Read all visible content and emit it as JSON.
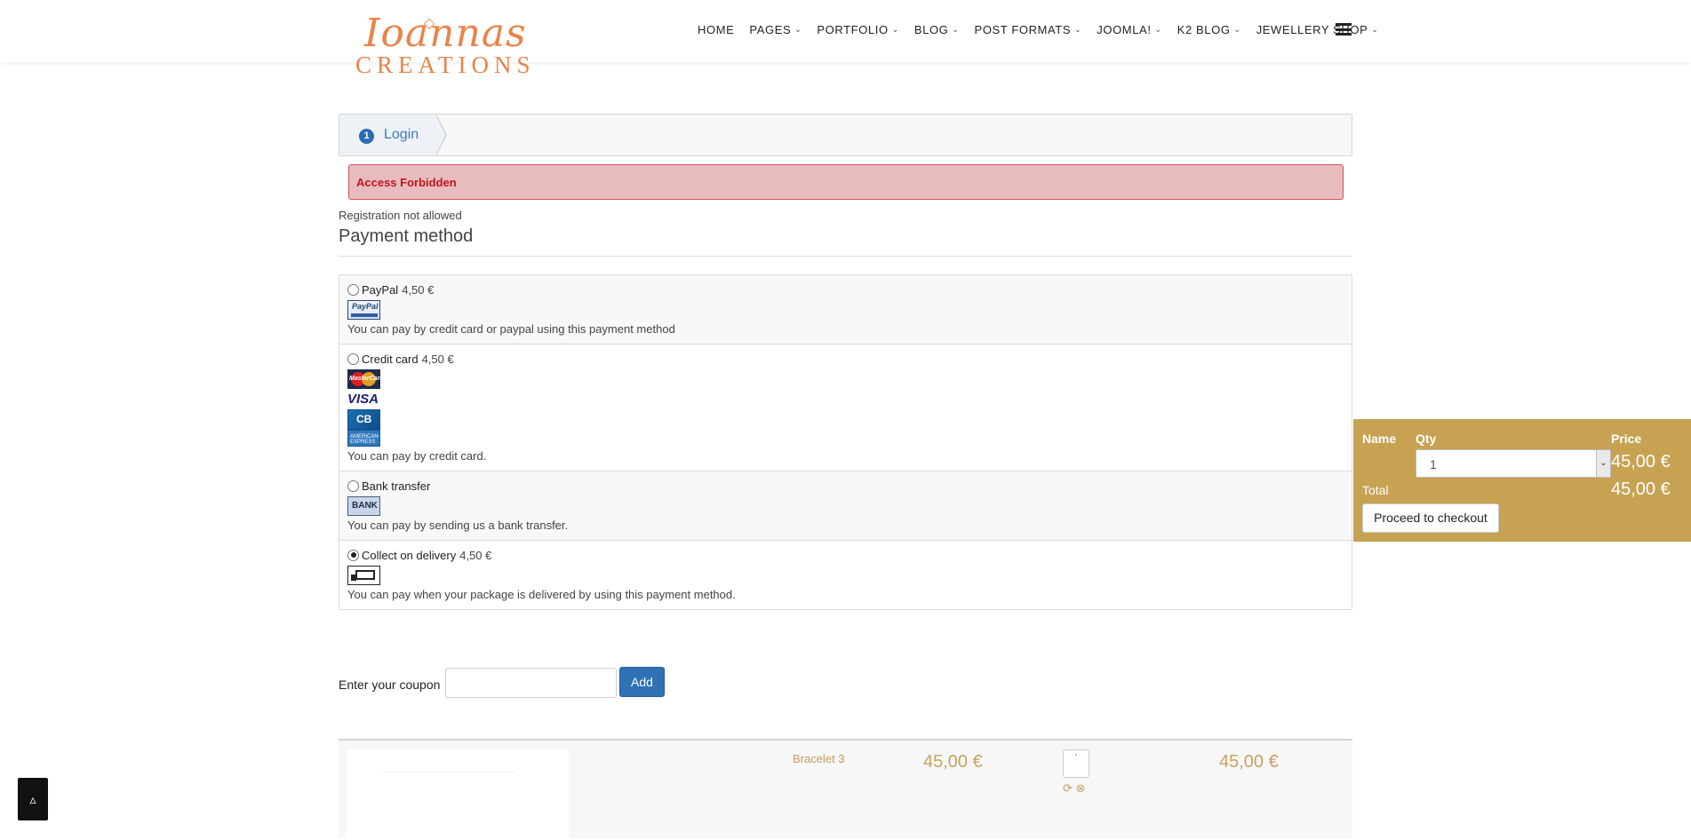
{
  "logo": {
    "line1": "Ioannas",
    "line2": "CREATIONS"
  },
  "nav": {
    "items": [
      {
        "label": "HOME",
        "dropdown": false
      },
      {
        "label": "PAGES",
        "dropdown": true
      },
      {
        "label": "PORTFOLIO",
        "dropdown": true
      },
      {
        "label": "BLOG",
        "dropdown": true
      },
      {
        "label": "POST FORMATS",
        "dropdown": true
      },
      {
        "label": "JOOMLA!",
        "dropdown": true
      },
      {
        "label": "K2 BLOG",
        "dropdown": true
      },
      {
        "label": "JEWELLERY SHOP",
        "dropdown": true
      }
    ]
  },
  "checkout_steps": {
    "number": "1",
    "label": "Login"
  },
  "alert": {
    "text": "Access Forbidden",
    "color": "#c0161f"
  },
  "registration_note": "Registration not allowed",
  "payment": {
    "title": "Payment method",
    "methods": [
      {
        "name": "PayPal",
        "price": "4,50 €",
        "description": "You can pay by credit card or paypal using this payment method",
        "selected": false,
        "logo_text": "PayPal"
      },
      {
        "name": "Credit card",
        "price": "4,50 €",
        "description": "You can pay by credit card.",
        "selected": false,
        "logo_text": "MasterCard"
      },
      {
        "name": "Bank transfer",
        "price": "",
        "description": "You can pay by sending us a bank transfer.",
        "selected": false,
        "logo_text": "BANK"
      },
      {
        "name": "Collect on delivery",
        "price": "4,50 €",
        "description": "You can pay when your package is delivered by using this payment method.",
        "selected": true,
        "logo_text": ""
      }
    ],
    "card_logos": {
      "visa": "VISA",
      "cb": "CB",
      "amex": "AMERICAN EXPRESS"
    }
  },
  "coupon": {
    "label": "Enter your coupon",
    "value": "",
    "button": "Add"
  },
  "cart_row": {
    "name": "Bracelet 3",
    "unit_price": "45,00 €",
    "qty": "'",
    "total": "45,00 €",
    "icons": [
      "refresh-icon",
      "remove-icon"
    ]
  },
  "mini_cart": {
    "col_name": "Name",
    "col_qty": "Qty",
    "col_price": "Price",
    "qty_value": "1",
    "price": "45,00 €",
    "total_label": "Total",
    "total": "45,00 €",
    "checkout_button": "Proceed to checkout",
    "background": "#c7a252"
  },
  "back_to_top": "▵"
}
